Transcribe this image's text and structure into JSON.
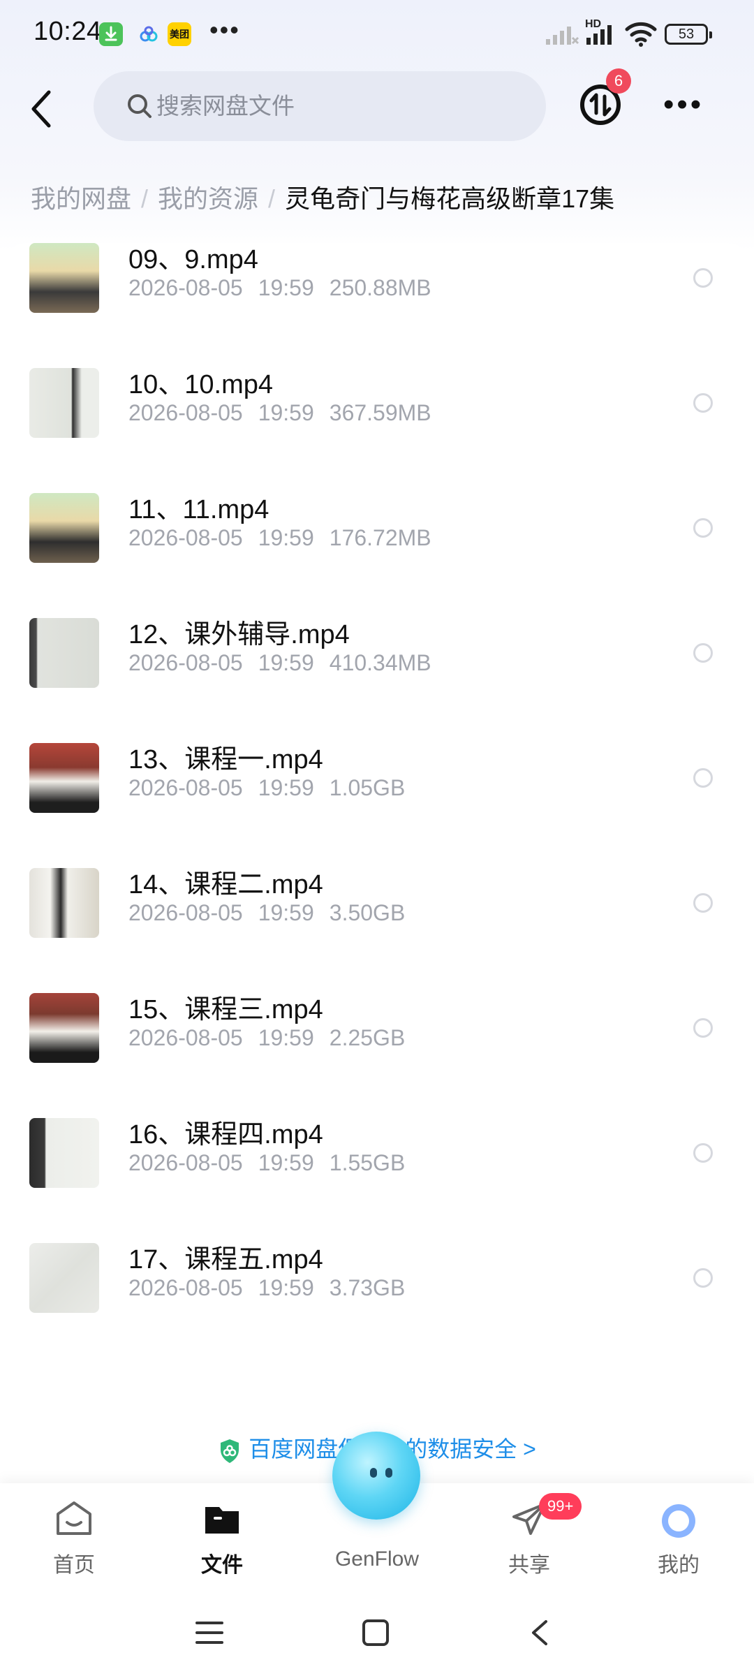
{
  "status_bar": {
    "time": "10:24",
    "meituan_label": "美团",
    "overflow": "•••",
    "network_label": "HD",
    "battery": "53"
  },
  "header": {
    "search_placeholder": "搜索网盘文件",
    "transfer_badge": "6",
    "more": "•••"
  },
  "breadcrumb": {
    "items": [
      "我的网盘",
      "我的资源"
    ],
    "separator": "/",
    "current": "灵龟奇门与梅花高级断章17集"
  },
  "files": [
    {
      "name": "09、9.mp4",
      "date": "2026-08-05",
      "time": "19:59",
      "size": "250.88MB"
    },
    {
      "name": "10、10.mp4",
      "date": "2026-08-05",
      "time": "19:59",
      "size": "367.59MB"
    },
    {
      "name": "11、11.mp4",
      "date": "2026-08-05",
      "time": "19:59",
      "size": "176.72MB"
    },
    {
      "name": "12、课外辅导.mp4",
      "date": "2026-08-05",
      "time": "19:59",
      "size": "410.34MB"
    },
    {
      "name": "13、课程一.mp4",
      "date": "2026-08-05",
      "time": "19:59",
      "size": "1.05GB"
    },
    {
      "name": "14、课程二.mp4",
      "date": "2026-08-05",
      "time": "19:59",
      "size": "3.50GB"
    },
    {
      "name": "15、课程三.mp4",
      "date": "2026-08-05",
      "time": "19:59",
      "size": "2.25GB"
    },
    {
      "name": "16、课程四.mp4",
      "date": "2026-08-05",
      "time": "19:59",
      "size": "1.55GB"
    },
    {
      "name": "17、课程五.mp4",
      "date": "2026-08-05",
      "time": "19:59",
      "size": "3.73GB"
    }
  ],
  "security_notice": "百度网盘保障你的数据安全 >",
  "tabs": [
    {
      "label": "首页",
      "icon": "home-icon"
    },
    {
      "label": "文件",
      "icon": "folder-icon"
    },
    {
      "label": "GenFlow",
      "icon": "genflow-icon"
    },
    {
      "label": "共享",
      "icon": "share-icon"
    },
    {
      "label": "我的",
      "icon": "profile-icon"
    }
  ],
  "share_badge": "99+",
  "colors": {
    "accent": "#1e8ee8",
    "badge": "#f04a5c",
    "secondary_text": "#a2a5ad"
  }
}
